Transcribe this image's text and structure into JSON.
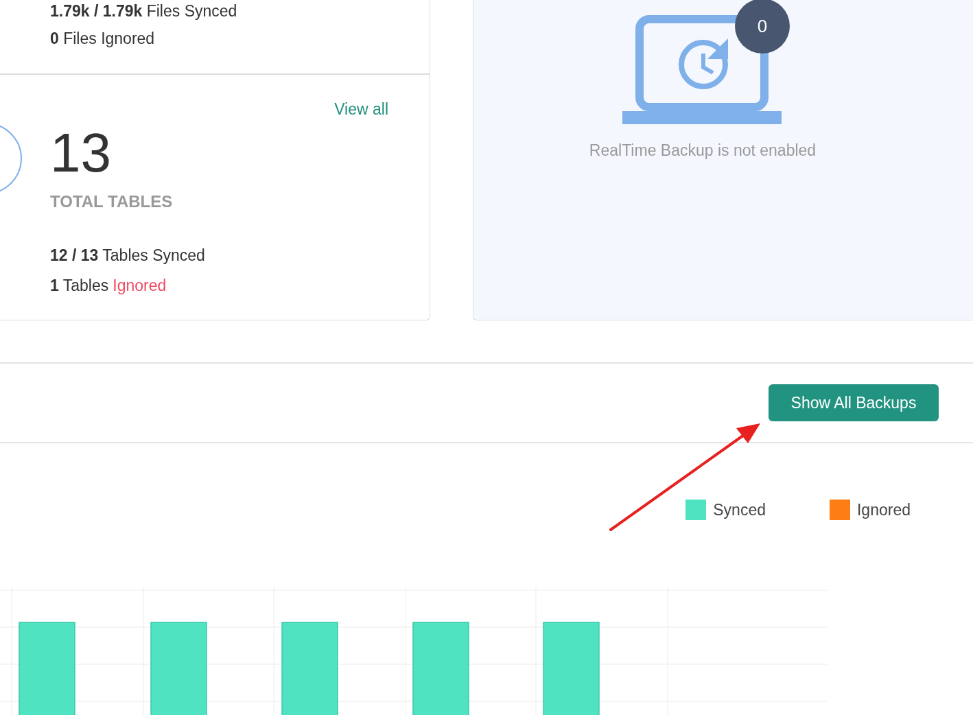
{
  "files_card": {
    "synced": "**1.79k / 1.79k** Files Synced",
    "ignored": "**0** Files Ignored"
  },
  "tables_card": {
    "link": "View all",
    "total": "13",
    "label": "TOTAL TABLES",
    "synced": "**12 / 13** Tables Synced",
    "ignored_prefix": "**1** Tables",
    "ignored_word": "Ignored"
  },
  "realtime_panel": {
    "badge": "0",
    "message": "RealTime Backup is not enabled"
  },
  "toolbar": {
    "button": "Show All Backups"
  },
  "legend": [
    {
      "label": "Synced",
      "color": "#4fe3c1"
    },
    {
      "label": "Ignored",
      "color": "#fd7e14"
    }
  ]
}
